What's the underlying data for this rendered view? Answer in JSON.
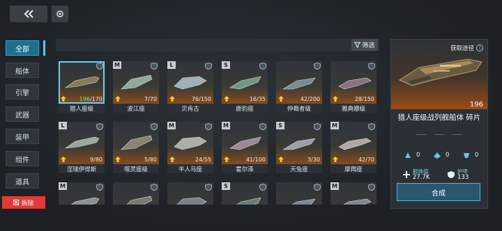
{
  "nav": {
    "back_icon": "double-chevron-left-icon",
    "refresh_icon": "refresh-icon"
  },
  "sidebar": {
    "items": [
      {
        "label": "全部",
        "active": true
      },
      {
        "label": "船体",
        "active": false
      },
      {
        "label": "引擎",
        "active": false
      },
      {
        "label": "武器",
        "active": false
      },
      {
        "label": "装甲",
        "active": false
      },
      {
        "label": "组件",
        "active": false
      },
      {
        "label": "道具",
        "active": false
      }
    ],
    "dismantle_label": "拆除"
  },
  "toolbar": {
    "filter_label": "筛选"
  },
  "grid": {
    "cards": [
      {
        "badge": "",
        "cur": "196",
        "max": "/170",
        "name": "猎人座级",
        "selected": true,
        "hue": "#8a7a52"
      },
      {
        "badge": "M",
        "cur": "7",
        "max": "/70",
        "name": "波江座",
        "selected": false,
        "hue": "#8fa8a0"
      },
      {
        "badge": "L",
        "cur": "76",
        "max": "/150",
        "name": "贝肯古",
        "selected": false,
        "hue": "#9fb0b8"
      },
      {
        "badge": "S",
        "cur": "16",
        "max": "/35",
        "name": "鹿豹座",
        "selected": false,
        "hue": "#6f9a7a"
      },
      {
        "badge": "",
        "cur": "42",
        "max": "/200",
        "name": "仲裁者级",
        "selected": false,
        "hue": "#7a8a90"
      },
      {
        "badge": "",
        "cur": "28",
        "max": "/150",
        "name": "雅典娜级",
        "selected": false,
        "hue": "#8a7080"
      },
      {
        "badge": "L",
        "cur": "9",
        "max": "/80",
        "name": "涅瑞伊得斯",
        "selected": false,
        "hue": "#9aa89a"
      },
      {
        "badge": "",
        "cur": "5",
        "max": "/80",
        "name": "噬灵座级",
        "selected": false,
        "hue": "#8a8470"
      },
      {
        "badge": "M",
        "cur": "24",
        "max": "/55",
        "name": "半人马座",
        "selected": false,
        "hue": "#a8b0a8"
      },
      {
        "badge": "M",
        "cur": "41",
        "max": "/100",
        "name": "霍尔泽",
        "selected": false,
        "hue": "#9a8a98"
      },
      {
        "badge": "S",
        "cur": "3",
        "max": "/30",
        "name": "天兔座",
        "selected": false,
        "hue": "#9aa0a8"
      },
      {
        "badge": "M",
        "cur": "42",
        "max": "/70",
        "name": "摩羯座",
        "selected": false,
        "hue": "#b0a8a0"
      },
      {
        "badge": "M",
        "cur": "",
        "max": "",
        "name": "",
        "selected": false,
        "hue": "#8a9490"
      },
      {
        "badge": "",
        "cur": "",
        "max": "",
        "name": "",
        "selected": false,
        "hue": "#7a7a70"
      },
      {
        "badge": "",
        "cur": "",
        "max": "",
        "name": "",
        "selected": false,
        "hue": "#7a8088"
      },
      {
        "badge": "S",
        "cur": "",
        "max": "",
        "name": "",
        "selected": false,
        "hue": "#6a8070"
      },
      {
        "badge": "",
        "cur": "",
        "max": "",
        "name": "",
        "selected": false,
        "hue": "#7a8898"
      },
      {
        "badge": "M",
        "cur": "",
        "max": "",
        "name": "",
        "selected": false,
        "hue": "#808890"
      }
    ]
  },
  "detail": {
    "acquire_label": "获取途径",
    "count": "196",
    "title": "猎人座级战列舰船体 碎片",
    "stat_values": [
      "0",
      "0",
      "0"
    ],
    "hull_label": "舰体值",
    "hull_value": "27.7K",
    "armor_label": "护甲",
    "armor_value": "133",
    "craft_label": "合成"
  }
}
